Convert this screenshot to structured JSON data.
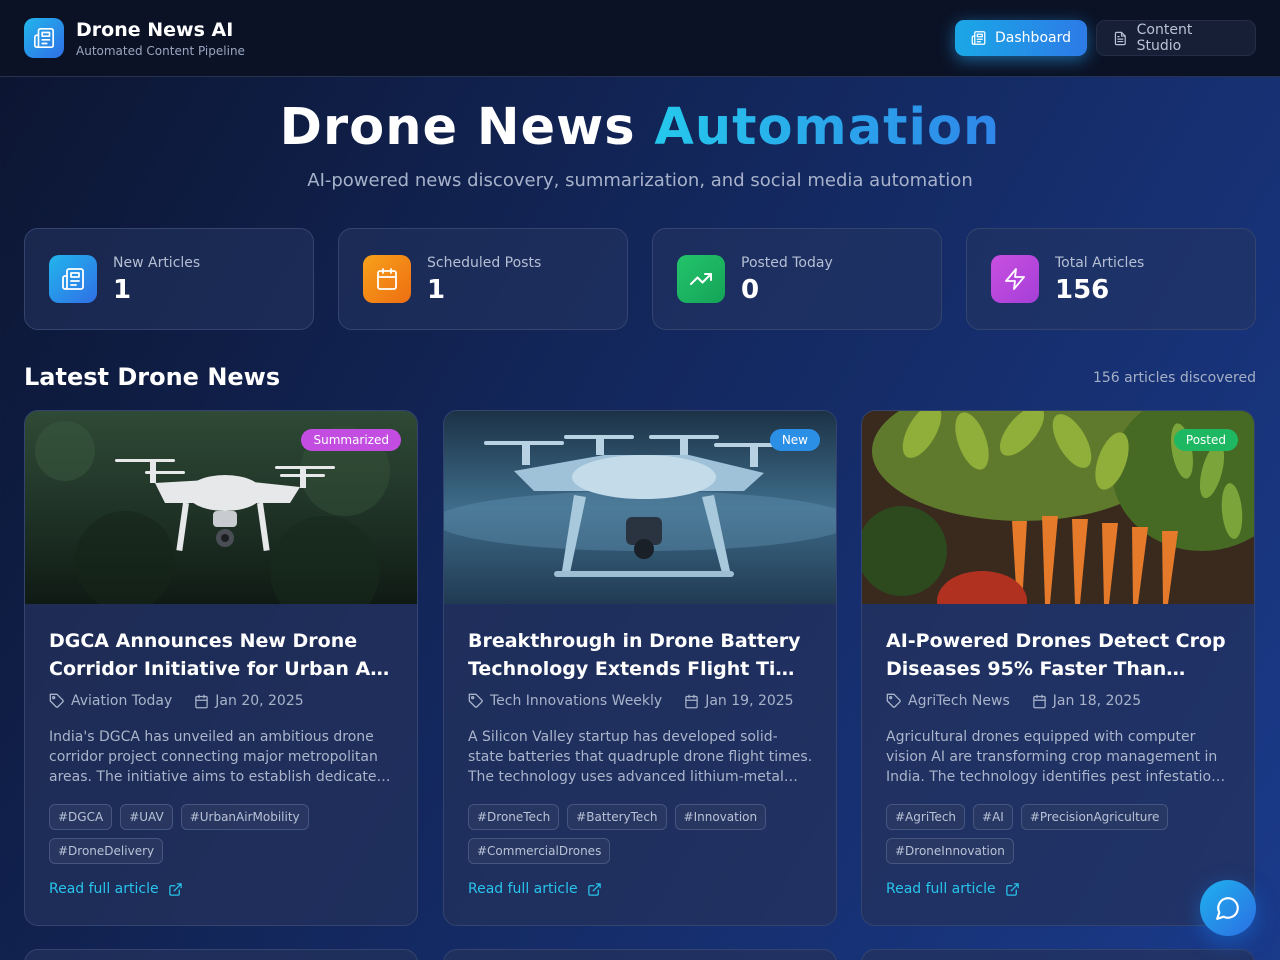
{
  "app": {
    "title": "Drone News AI",
    "subtitle": "Automated Content Pipeline",
    "logo_icon": "newspaper-icon"
  },
  "nav": {
    "dashboard": "Dashboard",
    "content_studio": "Content Studio",
    "active": "Dashboard"
  },
  "hero": {
    "title_main": "Drone News",
    "title_accent": "Automation",
    "subtitle": "AI-powered news discovery, summarization, and social media automation"
  },
  "stats": [
    {
      "label": "New Articles",
      "value": "1",
      "icon": "newspaper-icon",
      "color": "#2b8fe8"
    },
    {
      "label": "Scheduled Posts",
      "value": "1",
      "icon": "calendar-icon",
      "color": "#f28a1c"
    },
    {
      "label": "Posted Today",
      "value": "0",
      "icon": "trending-up-icon",
      "color": "#1fb661"
    },
    {
      "label": "Total Articles",
      "value": "156",
      "icon": "lightning-icon",
      "color": "#b54ee0"
    }
  ],
  "section": {
    "title": "Latest Drone News",
    "count": "156 articles discovered"
  },
  "articles": [
    {
      "badge": "Summarized",
      "badge_color": "#c24de0",
      "title_line1": "DGCA Announces New Drone",
      "title_line2": "Corridor Initiative for Urban Air…",
      "source": "Aviation Today",
      "date": "Jan 20, 2025",
      "excerpt_line1": "India's DGCA has unveiled an ambitious drone",
      "excerpt_line2": "corridor project connecting major metropolitan",
      "excerpt_line3": "areas. The initiative aims to establish dedicate…",
      "tags": [
        "#DGCA",
        "#UAV",
        "#UrbanAirMobility",
        "#DroneDelivery"
      ],
      "link": "Read full article"
    },
    {
      "badge": "New",
      "badge_color": "#2c8fe6",
      "title_line1": "Breakthrough in Drone Battery",
      "title_line2": "Technology Extends Flight Time…",
      "source": "Tech Innovations Weekly",
      "date": "Jan 19, 2025",
      "excerpt_line1": "A Silicon Valley startup has developed solid-",
      "excerpt_line2": "state batteries that quadruple drone flight times.",
      "excerpt_line3": "The technology uses advanced lithium-metal…",
      "tags": [
        "#DroneTech",
        "#BatteryTech",
        "#Innovation",
        "#CommercialDrones"
      ],
      "link": "Read full article"
    },
    {
      "badge": "Posted",
      "badge_color": "#1eb862",
      "title_line1": "AI-Powered Drones Detect Crop",
      "title_line2": "Diseases 95% Faster Than…",
      "source": "AgriTech News",
      "date": "Jan 18, 2025",
      "excerpt_line1": "Agricultural drones equipped with computer",
      "excerpt_line2": "vision AI are transforming crop management in",
      "excerpt_line3": "India. The technology identifies pest infestatio…",
      "tags": [
        "#AgriTech",
        "#AI",
        "#PrecisionAgriculture",
        "#DroneInnovation"
      ],
      "link": "Read full article"
    }
  ],
  "chat": {
    "icon": "chat-bubble-icon"
  }
}
